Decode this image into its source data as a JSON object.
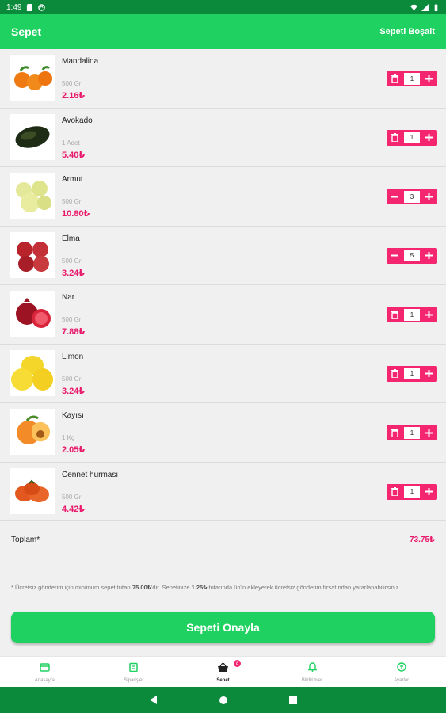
{
  "status": {
    "time": "1:49"
  },
  "appbar": {
    "title": "Sepet",
    "action": "Sepeti Boşalt"
  },
  "items": [
    {
      "name": "Mandalina",
      "unit": "500 Gr",
      "price": "2.16₺",
      "qty": "1",
      "left": "trash-icon",
      "fruit": "mandarin"
    },
    {
      "name": "Avokado",
      "unit": "1 Adet",
      "price": "5.40₺",
      "qty": "1",
      "left": "trash-icon",
      "fruit": "avocado"
    },
    {
      "name": "Armut",
      "unit": "500 Gr",
      "price": "10.80₺",
      "qty": "3",
      "left": "minus-icon",
      "fruit": "pear"
    },
    {
      "name": "Elma",
      "unit": "500 Gr",
      "price": "3.24₺",
      "qty": "5",
      "left": "minus-icon",
      "fruit": "apple"
    },
    {
      "name": "Nar",
      "unit": "500 Gr",
      "price": "7.88₺",
      "qty": "1",
      "left": "trash-icon",
      "fruit": "pomegranate"
    },
    {
      "name": "Limon",
      "unit": "500 Gr",
      "price": "3.24₺",
      "qty": "1",
      "left": "trash-icon",
      "fruit": "lemon"
    },
    {
      "name": "Kayısı",
      "unit": "1 Kg",
      "price": "2.05₺",
      "qty": "1",
      "left": "trash-icon",
      "fruit": "apricot"
    },
    {
      "name": "Cennet hurması",
      "unit": "500 Gr",
      "price": "4.42₺",
      "qty": "1",
      "left": "trash-icon",
      "fruit": "persimmon"
    }
  ],
  "total": {
    "label": "Toplam*",
    "value": "73.75₺"
  },
  "note": {
    "part1": "* Ücretsiz gönderim için minimum sepet tutarı ",
    "min": "75.00₺",
    "part2": "'dir. Sepetinize ",
    "diff": "1.25₺",
    "part3": " tutarında ürün ekleyerek ücretsiz gönderim fırsatından yararlanabilirsiniz"
  },
  "confirm_label": "Sepeti Onayla",
  "nav": [
    {
      "label": "Anasayfa",
      "icon": "home-icon"
    },
    {
      "label": "Siparişler",
      "icon": "orders-icon"
    },
    {
      "label": "Sepet",
      "icon": "basket-icon",
      "badge": "8",
      "active": true
    },
    {
      "label": "Bildirimler",
      "icon": "bell-icon"
    },
    {
      "label": "Ayarlar",
      "icon": "settings-icon"
    }
  ],
  "colors": {
    "primary": "#1fd160",
    "dark": "#0b8a3c",
    "accent": "#f4266f",
    "price": "#e8196a"
  }
}
